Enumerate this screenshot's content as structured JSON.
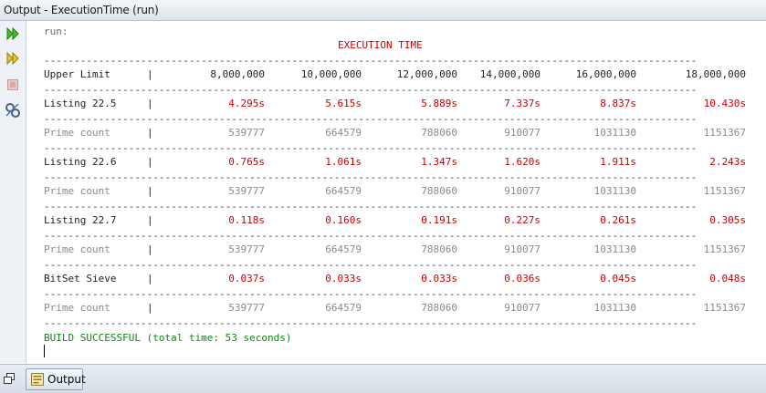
{
  "window": {
    "title": "Output - ExecutionTime (run)"
  },
  "sidebar": {
    "buttons": [
      "rerun-icon",
      "rerun-with-params-icon",
      "stop-icon",
      "settings-icon"
    ]
  },
  "console": {
    "run_label": "run:",
    "heading": "EXECUTION TIME",
    "divider": "------------------------------------------------------------------------------------------------------------",
    "pipe": "|",
    "header": {
      "label": "Upper Limit",
      "values": [
        "8,000,000",
        "10,000,000",
        "12,000,000",
        "14,000,000",
        "16,000,000",
        "18,000,000"
      ]
    },
    "results": [
      {
        "label": "Listing 22.5",
        "times": [
          "4.295s",
          "5.615s",
          "5.889s",
          "7.337s",
          "8.837s",
          "10.430s"
        ],
        "count_label": "Prime count",
        "counts": [
          "539777",
          "664579",
          "788060",
          "910077",
          "1031130",
          "1151367"
        ]
      },
      {
        "label": "Listing 22.6",
        "times": [
          "0.765s",
          "1.061s",
          "1.347s",
          "1.620s",
          "1.911s",
          "2.243s"
        ],
        "count_label": "Prime count",
        "counts": [
          "539777",
          "664579",
          "788060",
          "910077",
          "1031130",
          "1151367"
        ]
      },
      {
        "label": "Listing 22.7",
        "times": [
          "0.118s",
          "0.160s",
          "0.191s",
          "0.227s",
          "0.261s",
          "0.305s"
        ],
        "count_label": "Prime count",
        "counts": [
          "539777",
          "664579",
          "788060",
          "910077",
          "1031130",
          "1151367"
        ]
      },
      {
        "label": "BitSet Sieve",
        "times": [
          "0.037s",
          "0.033s",
          "0.033s",
          "0.036s",
          "0.045s",
          "0.048s"
        ],
        "count_label": "Prime count",
        "counts": [
          "539777",
          "664579",
          "788060",
          "910077",
          "1031130",
          "1151367"
        ]
      }
    ],
    "build_status": "BUILD SUCCESSFUL (total time: 53 seconds)"
  },
  "bottom": {
    "tab_label": "Output"
  },
  "colors": {
    "heading": "#c80000",
    "time": "#c80000",
    "count": "#8a8a8a",
    "build": "#118811"
  }
}
